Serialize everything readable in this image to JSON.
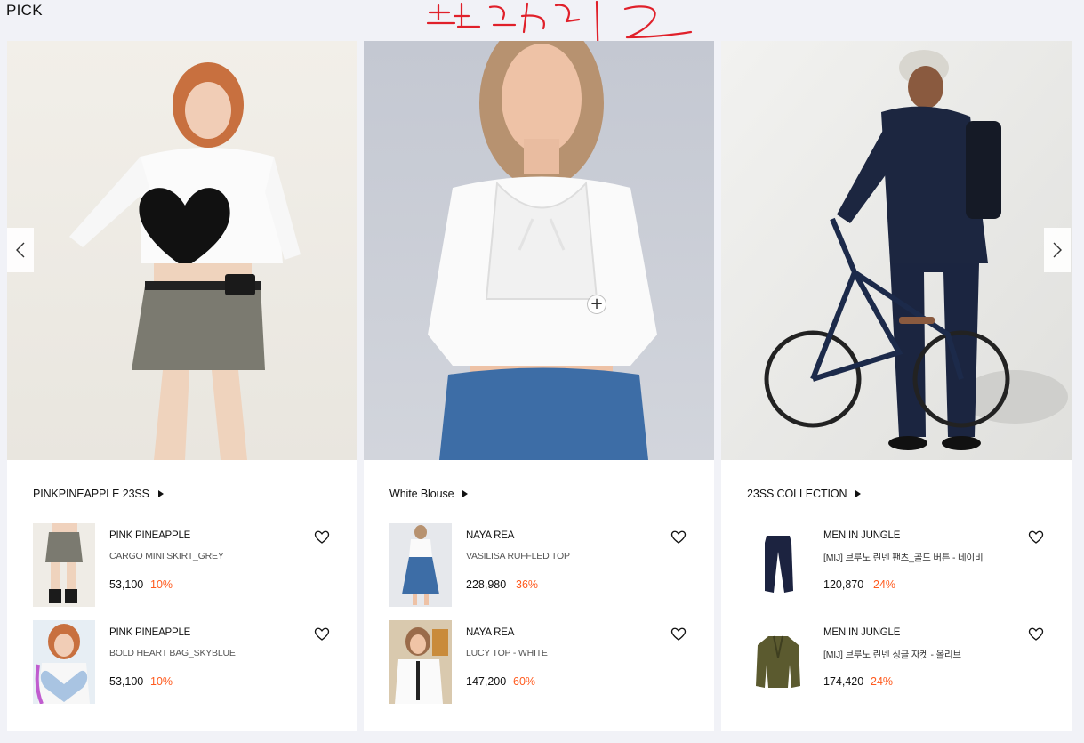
{
  "section": {
    "title": "PICK"
  },
  "cards": [
    {
      "collection": "PINKPINEAPPLE 23SS",
      "products": [
        {
          "brand": "PINK PINEAPPLE",
          "name": "CARGO MINI SKIRT_GREY",
          "price": "53,100",
          "discount": "10%"
        },
        {
          "brand": "PINK PINEAPPLE",
          "name": "BOLD HEART BAG_SKYBLUE",
          "price": "53,100",
          "discount": "10%"
        }
      ]
    },
    {
      "collection": "White Blouse",
      "products": [
        {
          "brand": "NAYA REA",
          "name": "VASILISA RUFFLED TOP",
          "price": "228,980",
          "discount": "36%"
        },
        {
          "brand": "NAYA REA",
          "name": "LUCY TOP - WHITE",
          "price": "147,200",
          "discount": "60%"
        }
      ]
    },
    {
      "collection": "23SS COLLECTION",
      "products": [
        {
          "brand": "MEN IN JUNGLE",
          "name": "[MIJ] 브루노 린넨 팬츠_골드 버튼 - 네이비",
          "price": "120,870",
          "discount": "24%"
        },
        {
          "brand": "MEN IN JUNGLE",
          "name": "[MIJ] 브루노 린넨 싱글 자켓 - 올리브",
          "price": "174,420",
          "discount": "24%"
        }
      ]
    }
  ],
  "icons": {
    "prev": "chevron-left-icon",
    "next": "chevron-right-icon",
    "wishlist": "heart-outline-icon",
    "hotspot": "plus-icon",
    "collection_arrow": "triangle-right-icon"
  },
  "colors": {
    "accent_discount": "#ff5b1f",
    "background": "#f1f2f7",
    "annotation": "#e0202a"
  }
}
